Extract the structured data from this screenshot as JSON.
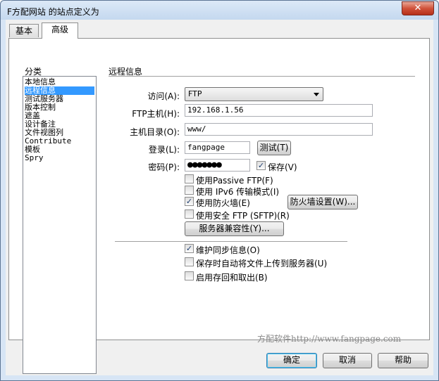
{
  "window": {
    "title": "F方配网站 的站点定义为",
    "close_glyph": "✕"
  },
  "tabs": [
    {
      "label": "基本"
    },
    {
      "label": "高级"
    }
  ],
  "categories": {
    "label": "分类",
    "items": [
      "本地信息",
      "远程信息",
      "测试服务器",
      "版本控制",
      "遮盖",
      "设计备注",
      "文件视图列",
      "Contribute",
      "模板",
      "Spry"
    ],
    "selected": "远程信息"
  },
  "remote": {
    "section_title": "远程信息",
    "access_label": "访问(A):",
    "access_value": "FTP",
    "ftp_host_label": "FTP主机(H):",
    "ftp_host_value": "192.168.1.56",
    "host_dir_label": "主机目录(O):",
    "host_dir_value": "www/",
    "login_label": "登录(L):",
    "login_value": "fangpage",
    "test_button": "测试(T)",
    "password_label": "密码(P):",
    "password_value": "●●●●●●●",
    "save_label": "保存(V)",
    "save_checked": true,
    "passive_label": "使用Passive FTP(F)",
    "passive_checked": false,
    "ipv6_label": "使用 IPv6 传输模式(I)",
    "ipv6_checked": false,
    "firewall_label": "使用防火墙(E)",
    "firewall_checked": true,
    "firewall_settings_button": "防火墙设置(W)...",
    "sftp_label": "使用安全 FTP (SFTP)(R)",
    "sftp_checked": false,
    "compat_button": "服务器兼容性(Y)...",
    "sync_label": "维护同步信息(O)",
    "sync_checked": true,
    "autoupload_label": "保存时自动将文件上传到服务器(U)",
    "autoupload_checked": false,
    "checkin_label": "启用存回和取出(B)",
    "checkin_checked": false
  },
  "watermark": "方配软件http://www.fangpage.com",
  "footer": {
    "ok": "确定",
    "cancel": "取消",
    "help": "帮助"
  }
}
